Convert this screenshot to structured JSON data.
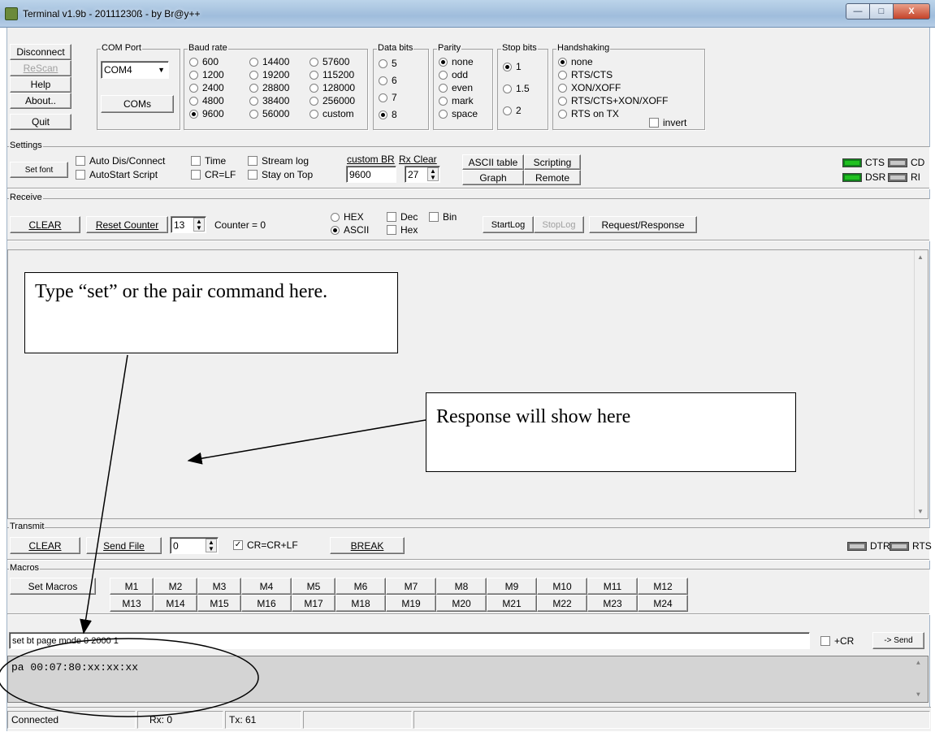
{
  "window": {
    "title": "Terminal v1.9b - 20111230ß - by Br@y++",
    "btn_min": "—",
    "btn_max": "□",
    "btn_close": "X"
  },
  "left_buttons": {
    "disconnect": "Disconnect",
    "rescan": "ReScan",
    "help": "Help",
    "about": "About..",
    "quit": "Quit"
  },
  "com_port": {
    "legend": "COM Port",
    "value": "COM4",
    "coms_button": "COMs"
  },
  "baud_rate": {
    "legend": "Baud rate",
    "options": [
      "600",
      "1200",
      "2400",
      "4800",
      "9600",
      "14400",
      "19200",
      "28800",
      "38400",
      "56000",
      "57600",
      "115200",
      "128000",
      "256000",
      "custom"
    ],
    "selected": "9600"
  },
  "data_bits": {
    "legend": "Data bits",
    "options": [
      "5",
      "6",
      "7",
      "8"
    ],
    "selected": "8"
  },
  "parity": {
    "legend": "Parity",
    "options": [
      "none",
      "odd",
      "even",
      "mark",
      "space"
    ],
    "selected": "none"
  },
  "stop_bits": {
    "legend": "Stop bits",
    "options": [
      "1",
      "1.5",
      "2"
    ],
    "selected": "1"
  },
  "handshaking": {
    "legend": "Handshaking",
    "options": [
      "none",
      "RTS/CTS",
      "XON/XOFF",
      "RTS/CTS+XON/XOFF",
      "RTS on TX"
    ],
    "selected": "none",
    "invert": "invert"
  },
  "settings": {
    "legend": "Settings",
    "set_font": "Set font",
    "auto_dis_connect": "Auto Dis/Connect",
    "autostart_script": "AutoStart Script",
    "time": "Time",
    "cr_lf": "CR=LF",
    "stream_log": "Stream log",
    "stay_on_top": "Stay on Top",
    "custom_br_label": "custom BR",
    "custom_br_value": "9600",
    "rx_clear_label": "Rx Clear",
    "rx_clear_value": "27",
    "ascii_table": "ASCII table",
    "scripting": "Scripting",
    "graph": "Graph",
    "remote": "Remote"
  },
  "leds": {
    "cts": "CTS",
    "cd": "CD",
    "dsr": "DSR",
    "ri": "RI",
    "dtr": "DTR",
    "rts": "RTS"
  },
  "receive": {
    "legend": "Receive",
    "clear": "CLEAR",
    "reset_counter": "Reset Counter",
    "counter_value": "13",
    "counter_label": "Counter = 0",
    "hex": "HEX",
    "ascii": "ASCII",
    "dec": "Dec",
    "hex_chk": "Hex",
    "bin": "Bin",
    "startlog": "StartLog",
    "stoplog": "StopLog",
    "request_response": "Request/Response"
  },
  "transmit": {
    "legend": "Transmit",
    "clear": "CLEAR",
    "send_file": "Send File",
    "spin_value": "0",
    "cr_crlf": "CR=CR+LF",
    "break": "BREAK"
  },
  "macros": {
    "legend": "Macros",
    "set_macros": "Set Macros",
    "row1": [
      "M1",
      "M2",
      "M3",
      "M4",
      "M5",
      "M6",
      "M7",
      "M8",
      "M9",
      "M10",
      "M11",
      "M12"
    ],
    "row2": [
      "M13",
      "M14",
      "M15",
      "M16",
      "M17",
      "M18",
      "M19",
      "M20",
      "M21",
      "M22",
      "M23",
      "M24"
    ]
  },
  "input": {
    "value": "set bt page mode 0 2000 1",
    "plus_cr": "+CR",
    "send": "-> Send"
  },
  "tx_text": "pa 00:07:80:xx:xx:xx",
  "status": {
    "connected": "Connected",
    "rx": "Rx: 0",
    "tx": "Tx: 61"
  },
  "annotations": {
    "type_note": "Type “set” or the pair command here.",
    "response_note": "Response will show here"
  }
}
